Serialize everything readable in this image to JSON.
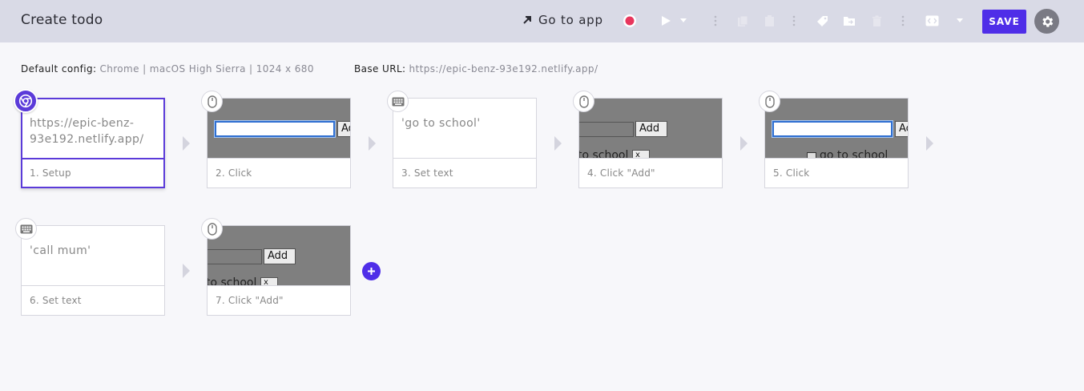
{
  "header": {
    "title": "Create todo",
    "goto_label": "Go to app",
    "save_label": "SAVE"
  },
  "config": {
    "default_label": "Default config:",
    "default_value": "Chrome | macOS High Sierra | 1024 x 680",
    "base_label": "Base URL:",
    "base_value": "https://epic-benz-93e192.netlify.app/"
  },
  "steps": [
    {
      "caption": "1. Setup",
      "content": "https://epic-benz-93e192.netlify.app/"
    },
    {
      "caption": "2. Click",
      "shot": {
        "button": "Ad"
      }
    },
    {
      "caption": "3. Set text",
      "content": "'go to school'"
    },
    {
      "caption": "4. Click \"Add\"",
      "shot": {
        "button": "Add",
        "text": "to school",
        "xbtn": "x"
      }
    },
    {
      "caption": "5. Click",
      "shot": {
        "button": "Ac",
        "text": "go to school"
      }
    },
    {
      "caption": "6. Set text",
      "content": "'call mum'"
    },
    {
      "caption": "7. Click \"Add\"",
      "shot": {
        "button": "Add",
        "text": "to school",
        "xbtn": "x"
      }
    }
  ],
  "colors": {
    "accent": "#4f2ee8",
    "header_bg": "#d9dae6",
    "record": "#e8365d"
  }
}
